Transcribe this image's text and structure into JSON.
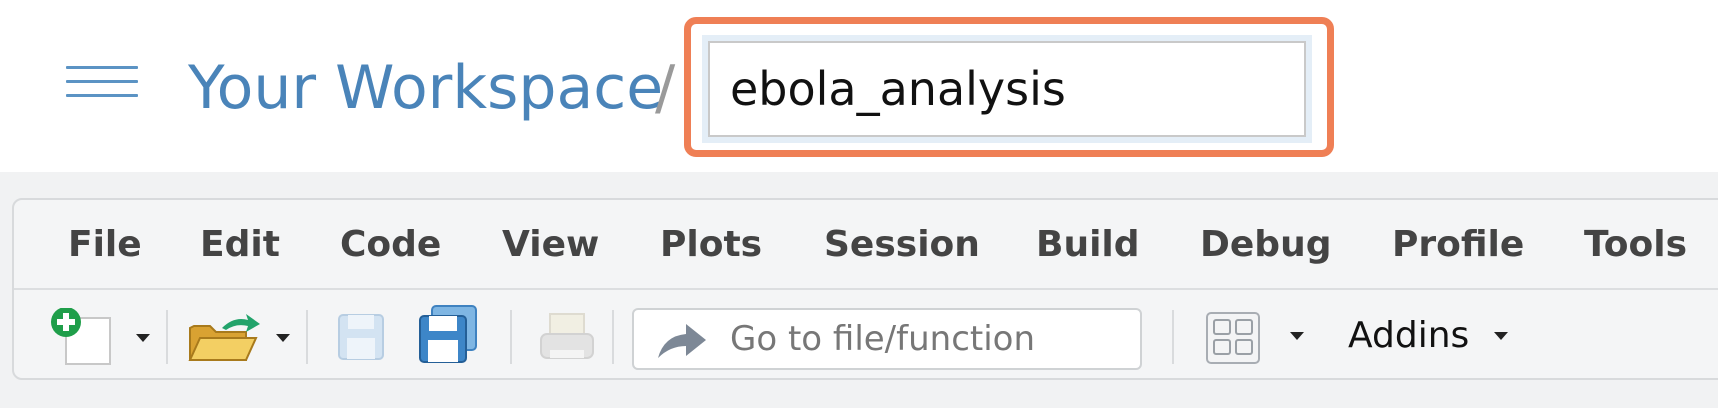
{
  "header": {
    "workspace_link": "Your Workspace",
    "separator": "/",
    "project_name": "ebola_analysis"
  },
  "menu": {
    "items": [
      "File",
      "Edit",
      "Code",
      "View",
      "Plots",
      "Session",
      "Build",
      "Debug",
      "Profile",
      "Tools"
    ]
  },
  "toolbar": {
    "goto_placeholder": "Go to file/function",
    "addins_label": "Addins",
    "icons": [
      "new-file-icon",
      "open-folder-icon",
      "save-icon",
      "save-all-icon",
      "print-icon",
      "goto-arrow-icon",
      "grid-layout-icon"
    ]
  },
  "colors": {
    "highlight": "#ef7f55",
    "link": "#4a84b9",
    "add_green": "#1f9e4a"
  }
}
